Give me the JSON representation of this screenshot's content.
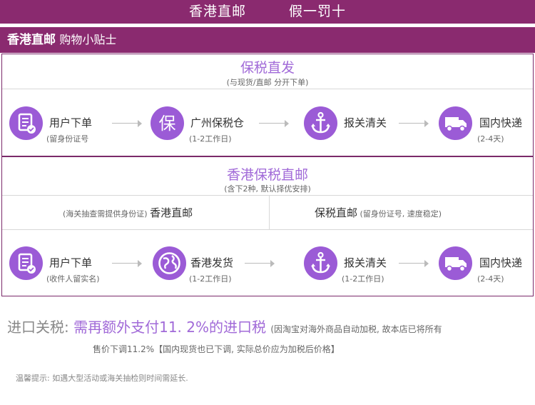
{
  "header": {
    "left": "香港直邮",
    "right": "假一罚十"
  },
  "subheader": {
    "title": "香港直邮",
    "subtitle": "购物小贴士"
  },
  "section1": {
    "title": "保税直发",
    "subtitle": "(与现货/直邮 分开下单)",
    "steps": [
      {
        "label": "用户下单",
        "note": "(留身份证号",
        "icon": "document-check-icon"
      },
      {
        "label": "广州保税仓",
        "note": "(1-2工作日)",
        "icon": "bonded-warehouse-icon"
      },
      {
        "label": "报关清关",
        "note": "",
        "icon": "anchor-icon"
      },
      {
        "label": "国内快递",
        "note": "(2-4天)",
        "icon": "delivery-truck-icon"
      }
    ]
  },
  "section2": {
    "title": "香港保税直邮",
    "subtitle": "(含下2种, 默认择优安排)",
    "options": {
      "left_note": "(海关抽查需提供身份证)",
      "left_label": "香港直邮",
      "right_label": "保税直邮",
      "right_note": "(留身份证号, 速度稳定)"
    },
    "steps": [
      {
        "label": "用户下单",
        "note": "(收件人留实名)",
        "icon": "document-check-icon"
      },
      {
        "label": "香港发货",
        "note": "(1-2工作日)",
        "icon": "globe-icon"
      },
      {
        "label": "报关清关",
        "note": "(1-2工作日)",
        "icon": "anchor-icon"
      },
      {
        "label": "国内快递",
        "note": "(2-4天)",
        "icon": "delivery-truck-icon"
      }
    ]
  },
  "tax": {
    "label": "进口关税:",
    "highlight": "需再额外支付11. 2%的进口税",
    "note_part1": "(因淘宝对海外商品自动加税, 故本店已将所有",
    "note_part2": "售价下调11.2%【国内现货也已下调, 实际总价应为加税后价格】"
  },
  "tip": "温馨提示: 如遇大型活动或海关抽检则时间需延长.",
  "colors": {
    "brand_bar": "#8a2a6f",
    "accent": "#a16ad8",
    "icon_circle": "#9b5bd6"
  }
}
